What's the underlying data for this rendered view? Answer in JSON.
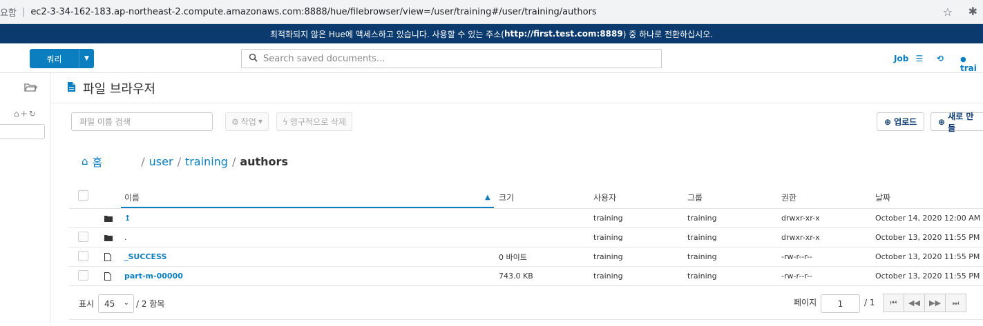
{
  "browser": {
    "insecure_label": "요함",
    "url": "ec2-3-34-162-183.ap-northeast-2.compute.amazonaws.com:8888/hue/filebrowser/view=/user/training#/user/training/authors"
  },
  "banner": {
    "text_before": "최적화되지 않은 Hue에 액세스하고 있습니다. 사용할 수 있는 주소(",
    "url": "http://first.test.com:8889",
    "text_after": ") 중 하나로 전환하십시오."
  },
  "navbar": {
    "query_button": "쿼리",
    "search_placeholder": "Search saved documents...",
    "jobs_label": "Job",
    "user_label": "trai"
  },
  "page": {
    "title": "파일 브라우저",
    "filter_placeholder": "파일 이름 검색",
    "actions_label": "작업",
    "delete_label": "영구적으로 삭제",
    "upload_label": "업로드",
    "new_label": "새로 만들"
  },
  "breadcrumb": {
    "home": "홈",
    "parts": [
      "user",
      "training"
    ],
    "current": "authors"
  },
  "table": {
    "headers": {
      "name": "이름",
      "size": "크기",
      "user": "사용자",
      "group": "그룹",
      "perm": "권한",
      "date": "날짜"
    },
    "rows": [
      {
        "icon": "folder-icon",
        "name": "↥",
        "size": "",
        "user": "training",
        "group": "training",
        "perm": "drwxr-xr-x",
        "date": "October 14, 2020 12:00 AM"
      },
      {
        "icon": "folder-icon",
        "name": ".",
        "size": "",
        "user": "training",
        "group": "training",
        "perm": "drwxr-xr-x",
        "date": "October 13, 2020 11:55 PM"
      },
      {
        "icon": "file-icon",
        "name": "_SUCCESS",
        "size": "0 바이트",
        "user": "training",
        "group": "training",
        "perm": "-rw-r--r--",
        "date": "October 13, 2020 11:55 PM"
      },
      {
        "icon": "file-icon",
        "name": "part-m-00000",
        "size": "743.0 KB",
        "user": "training",
        "group": "training",
        "perm": "-rw-r--r--",
        "date": "October 13, 2020 11:55 PM"
      }
    ]
  },
  "footer": {
    "show_label": "표시",
    "page_size": "45",
    "count_label": "/ 2 항목",
    "page_label": "페이지",
    "page_value": "1",
    "page_total": "/ 1"
  }
}
